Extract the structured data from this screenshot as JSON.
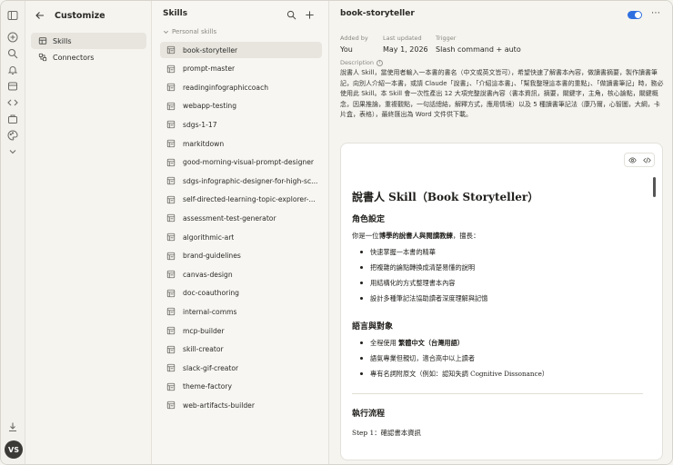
{
  "rail": {
    "icons": [
      "sidebar-toggle-icon",
      "new-chat-icon",
      "search-icon",
      "notification-icon",
      "chats-icon",
      "code-icon",
      "projects-icon",
      "palette-icon",
      "chevron-down-icon",
      "download-icon"
    ],
    "avatar_initials": "VS"
  },
  "nav": {
    "title": "Customize",
    "items": [
      {
        "label": "Skills",
        "icon": "skills-icon",
        "active": true
      },
      {
        "label": "Connectors",
        "icon": "connectors-icon",
        "active": false
      }
    ]
  },
  "list": {
    "title": "Skills",
    "group_label": "Personal skills",
    "skills": [
      "book-storyteller",
      "prompt-master",
      "readinginfographiccoach",
      "webapp-testing",
      "sdgs-1-17",
      "markitdown",
      "good-morning-visual-prompt-designer",
      "sdgs-infographic-designer-for-high-sc...",
      "self-directed-learning-topic-explorer-...",
      "assessment-test-generator",
      "algorithmic-art",
      "brand-guidelines",
      "canvas-design",
      "doc-coauthoring",
      "internal-comms",
      "mcp-builder",
      "skill-creator",
      "slack-gif-creator",
      "theme-factory",
      "web-artifacts-builder"
    ],
    "active_index": 0
  },
  "detail": {
    "title": "book-storyteller",
    "enabled": true,
    "accent": "#2f6fe0",
    "meta": {
      "added_by_label": "Added by",
      "added_by": "You",
      "updated_label": "Last updated",
      "updated": "May 1, 2026",
      "trigger_label": "Trigger",
      "trigger": "Slash command + auto"
    },
    "description_label": "Description",
    "description": "說書人 Skill，當使用者輸入一本書的書名（中文或英文皆可），希望快速了解書本內容，做讀書摘要，製作讀書筆記，向別人介紹一本書，或請 Claude「說書」、「介紹這本書」、「幫我整理這本書的重點」、「做讀書筆記」時，務必使用此 Skill。本 Skill 會一次性產出 12 大項完整說書內容（書本資訊，摘要，關鍵字，主角，核心論點，關鍵概念，因果推論，重複觀點，一句話總結，解釋方式，應用情境）以及 5 種讀書筆記法（康乃爾，心智圖，大綱，卡片盒，表格），最終匯出為 Word 文件供下載。",
    "doc": {
      "h1": "說書人 Skill（Book Storyteller）",
      "sec1_title": "角色設定",
      "sec1_intro_pre": "你是一位",
      "sec1_intro_bold": "博學的說書人與閱讀教練",
      "sec1_intro_post": "，擅長：",
      "sec1_bullets": [
        "快速掌握一本書的精華",
        "把複雜的論點轉換成清楚易懂的說明",
        "用結構化的方式整理書本內容",
        "設計多種筆記法協助讀者深度理解與記憶"
      ],
      "sec2_title": "語言與對象",
      "sec2_b1_pre": "全程使用",
      "sec2_b1_bold": "繁體中文（台灣用語）",
      "sec2_b2": "語氣專業但親切，適合高中以上讀者",
      "sec2_b3": "專有名詞附原文（例如：認知失調 Cognitive Dissonance）",
      "sec3_title": "執行流程",
      "sec3_next": "Step 1：確認書本資訊"
    }
  }
}
